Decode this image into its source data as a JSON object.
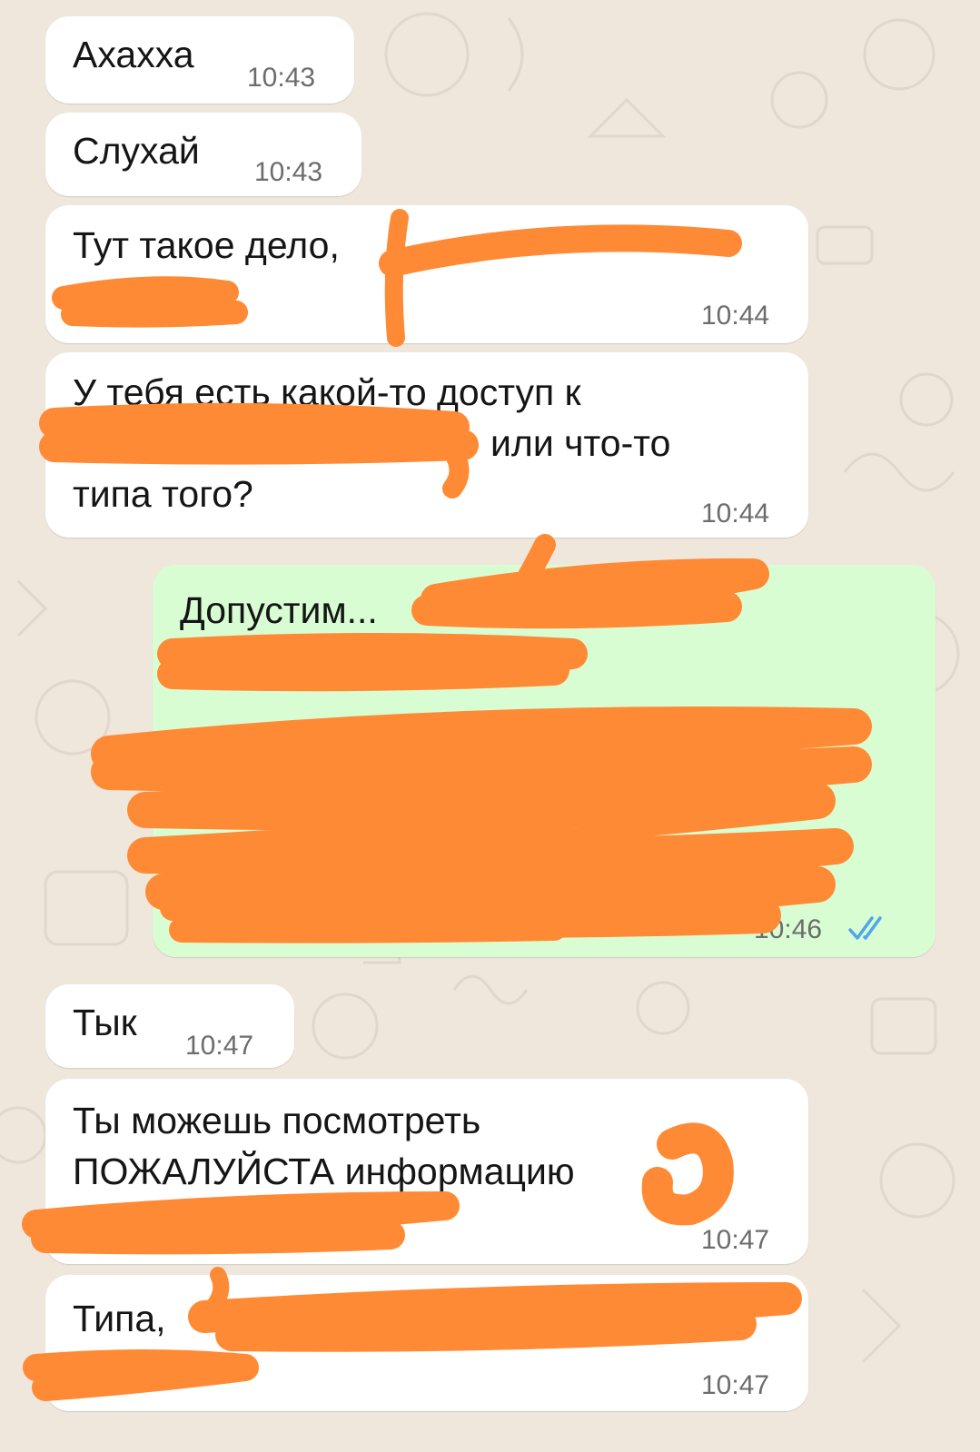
{
  "chat": {
    "messages": [
      {
        "dir": "in",
        "text": "Ахахха",
        "time": "10:43"
      },
      {
        "dir": "in",
        "text": "Слухай",
        "time": "10:43"
      },
      {
        "dir": "in",
        "line1": "Тут такое дело,",
        "time": "10:44"
      },
      {
        "dir": "in",
        "line1": "У тебя есть какой-то доступ к",
        "line2": "или что-то",
        "line3": "типа того?",
        "time": "10:44"
      },
      {
        "dir": "out",
        "text": "Допустим...",
        "time": "10:46",
        "status": "read"
      },
      {
        "dir": "in",
        "text": "Тык",
        "time": "10:47"
      },
      {
        "dir": "in",
        "line1": "Ты можешь посмотреть",
        "line2": "ПОЖАЛУЙСТА информацию",
        "time": "10:47"
      },
      {
        "dir": "in",
        "line1": "Типа,",
        "time": "10:47"
      }
    ]
  },
  "colors": {
    "wallpaper": "#efe7dc",
    "incoming_bubble": "#ffffff",
    "outgoing_bubble": "#d9fdd3",
    "read_ticks": "#4fa6ea",
    "redaction": "#ff8a35"
  },
  "icons": {
    "read_receipt": "double-check-icon"
  }
}
